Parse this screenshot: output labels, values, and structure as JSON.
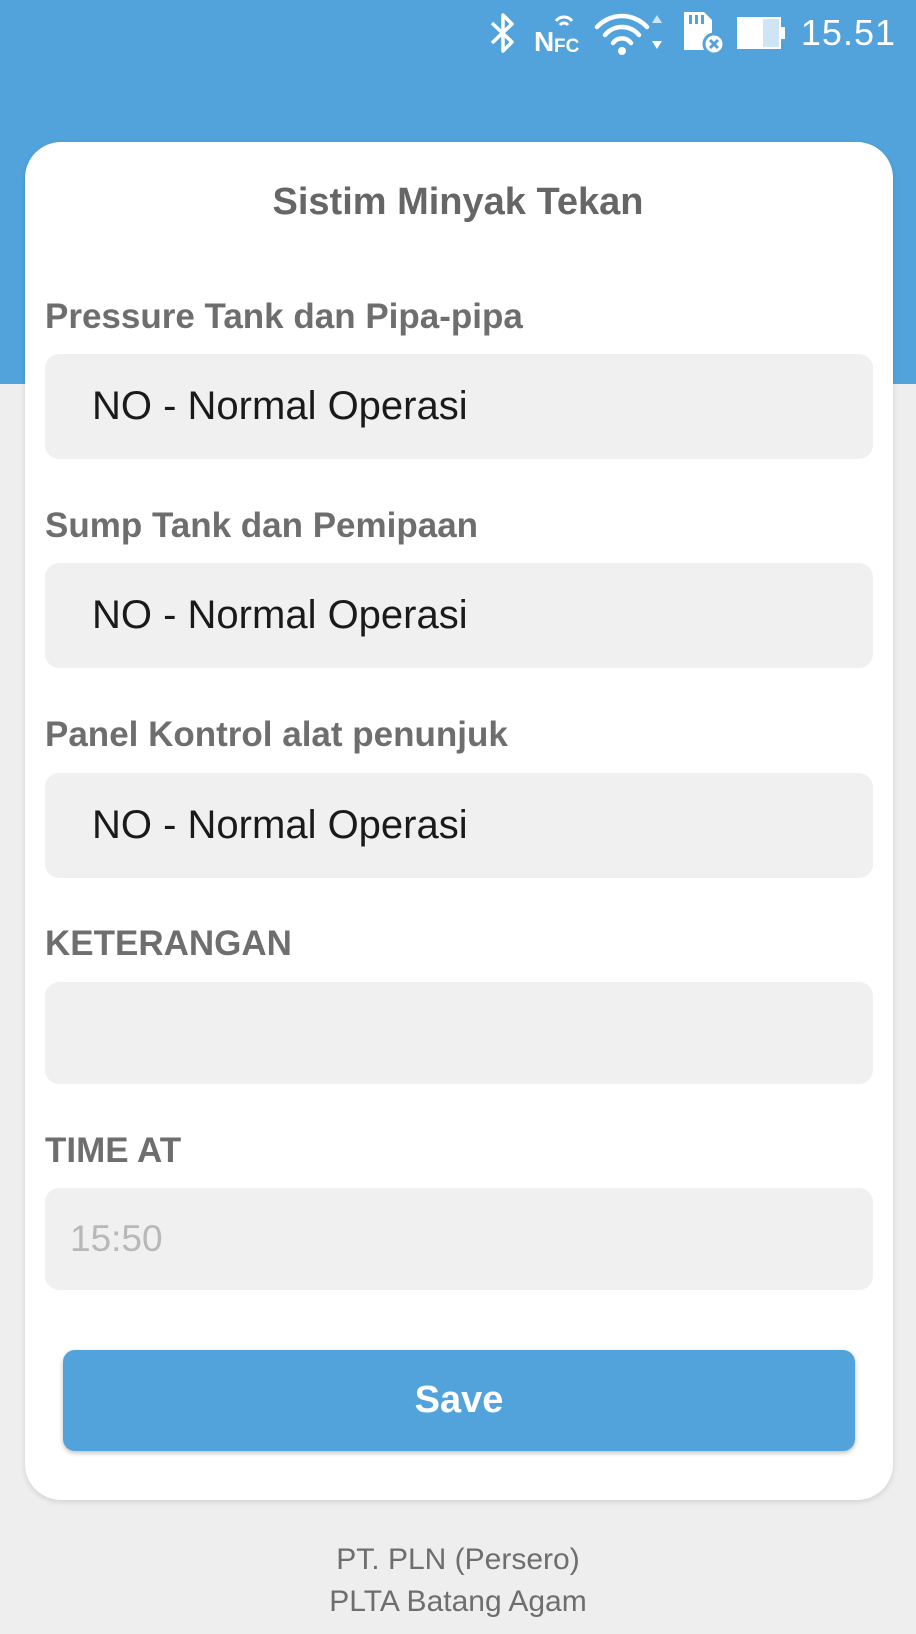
{
  "status_bar": {
    "time": "15.51",
    "icons": [
      "bluetooth-icon",
      "nfc-icon",
      "wifi-icon",
      "sd-card-error-icon",
      "battery-icon"
    ],
    "nfc_label": "N",
    "nfc_sub": "FC"
  },
  "form": {
    "title": "Sistim Minyak Tekan",
    "fields": [
      {
        "label": "Pressure Tank dan Pipa-pipa",
        "value": "NO - Normal Operasi"
      },
      {
        "label": "Sump Tank dan Pemipaan",
        "value": "NO - Normal Operasi"
      },
      {
        "label": "Panel Kontrol alat penunjuk",
        "value": "NO - Normal Operasi"
      }
    ],
    "keterangan": {
      "label": "KETERANGAN",
      "value": ""
    },
    "time_at": {
      "label": "TIME AT",
      "value": "15:50"
    },
    "save_label": "Save"
  },
  "footer": {
    "line1": "PT. PLN (Persero)",
    "line2": "PLTA Batang Agam"
  },
  "colors": {
    "primary": "#52a3dc",
    "background": "#eeeeee",
    "card": "#ffffff",
    "field": "#f0f0f0"
  }
}
